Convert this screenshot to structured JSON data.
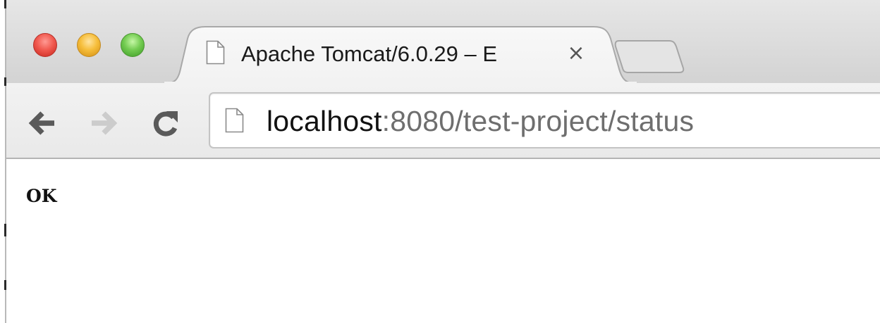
{
  "tab": {
    "title": "Apache Tomcat/6.0.29 – E",
    "icon": "document-icon",
    "close_glyph": "×"
  },
  "toolbar": {
    "back_icon": "back-arrow-icon",
    "forward_icon": "forward-arrow-icon",
    "reload_icon": "reload-icon"
  },
  "address_bar": {
    "host": "localhost",
    "rest": ":8080/test-project/status",
    "icon": "document-icon"
  },
  "page": {
    "body_text": "OK"
  },
  "colors": {
    "close_red": "#f15a50",
    "minimize_yellow": "#f6be3b",
    "zoom_green": "#74cc52"
  }
}
